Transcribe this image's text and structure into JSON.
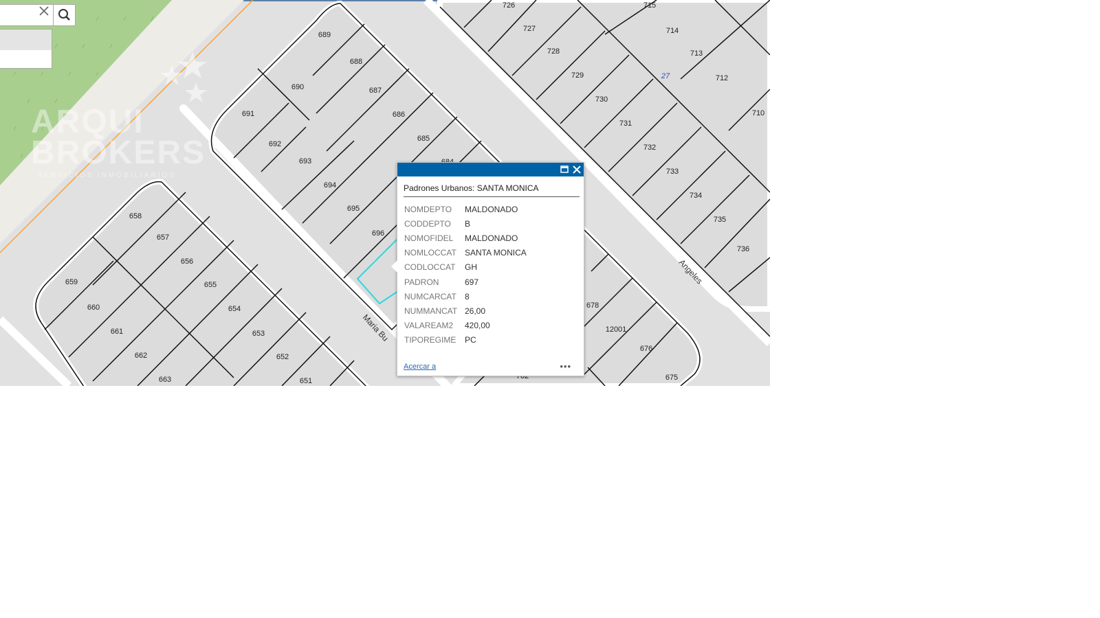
{
  "search": {
    "value": "",
    "clear_icon": "close-icon",
    "button_icon": "search-icon"
  },
  "watermark": {
    "line1": "ARQUI",
    "line2": "BROKERS",
    "line3": "SERVICIOS INMOBILIARIOS"
  },
  "streets": [
    {
      "name": "Maria Bu"
    },
    {
      "name": "Angeles"
    }
  ],
  "parcels": [
    "726",
    "727",
    "728",
    "729",
    "730",
    "731",
    "732",
    "733",
    "734",
    "735",
    "736",
    "715",
    "714",
    "713",
    "712",
    "710",
    "27",
    "689",
    "688",
    "687",
    "686",
    "685",
    "684",
    "690",
    "691",
    "692",
    "693",
    "694",
    "695",
    "696",
    "658",
    "657",
    "656",
    "655",
    "654",
    "653",
    "652",
    "651",
    "659",
    "660",
    "661",
    "662",
    "663",
    "678",
    "12001",
    "676",
    "675",
    "702"
  ],
  "popup": {
    "title": "Padrones Urbanos: SANTA MONICA",
    "attributes": [
      {
        "key": "NOMDEPTO",
        "value": "MALDONADO"
      },
      {
        "key": "CODDEPTO",
        "value": "B"
      },
      {
        "key": "NOMOFIDEL",
        "value": "MALDONADO"
      },
      {
        "key": "NOMLOCCAT",
        "value": "SANTA MONICA"
      },
      {
        "key": "CODLOCCAT",
        "value": "GH"
      },
      {
        "key": "PADRON",
        "value": "697"
      },
      {
        "key": "NUMCARCAT",
        "value": "8"
      },
      {
        "key": "NUMMANCAT",
        "value": "26,00"
      },
      {
        "key": "VALAREAM2",
        "value": "420,00"
      },
      {
        "key": "TIPOREGIME",
        "value": "PC"
      }
    ],
    "zoom_link": "Acercar a",
    "more_label": "•••",
    "maximize_icon": "maximize-icon",
    "close_icon": "close-icon"
  },
  "colors": {
    "header": "#0063a8",
    "highlight": "#2fd6e0",
    "park": "#a9cf8f",
    "road_line": "#f1a340"
  }
}
